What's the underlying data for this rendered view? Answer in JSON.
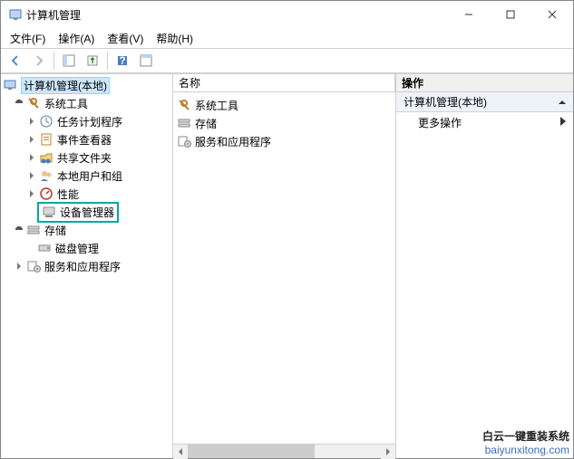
{
  "window": {
    "title": "计算机管理"
  },
  "menu": {
    "file": "文件(F)",
    "action": "操作(A)",
    "view": "查看(V)",
    "help": "帮助(H)"
  },
  "left": {
    "root": "计算机管理(本地)",
    "systools": "系统工具",
    "taskScheduler": "任务计划程序",
    "eventViewer": "事件查看器",
    "sharedFolders": "共享文件夹",
    "localUsers": "本地用户和组",
    "performance": "性能",
    "deviceManager": "设备管理器",
    "storage": "存储",
    "diskMgmt": "磁盘管理",
    "services": "服务和应用程序"
  },
  "mid": {
    "header": "名称",
    "items": {
      "systools": "系统工具",
      "storage": "存储",
      "services": "服务和应用程序"
    }
  },
  "right": {
    "header": "操作",
    "context": "计算机管理(本地)",
    "moreActions": "更多操作"
  },
  "watermark": {
    "brand": "白云一键重装系统",
    "url": "baiyunxitong.com"
  }
}
